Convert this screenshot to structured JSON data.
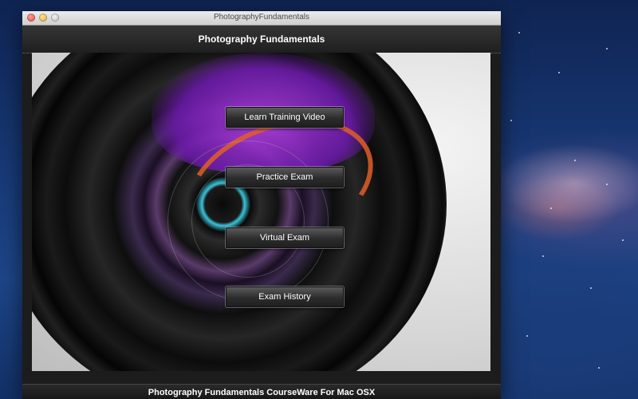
{
  "window": {
    "title": "PhotographyFundamentals"
  },
  "header": {
    "title": "Photography Fundamentals"
  },
  "menu": [
    {
      "label": "Learn Training Video"
    },
    {
      "label": "Practice Exam"
    },
    {
      "label": "Virtual Exam"
    },
    {
      "label": "Exam History"
    }
  ],
  "footer": {
    "text": "Photography Fundamentals CourseWare For Mac OSX"
  },
  "colors": {
    "accent": "#ffffff",
    "close": "#e0443a",
    "minimize": "#e0a52a",
    "zoom": "#b8b8b8"
  }
}
